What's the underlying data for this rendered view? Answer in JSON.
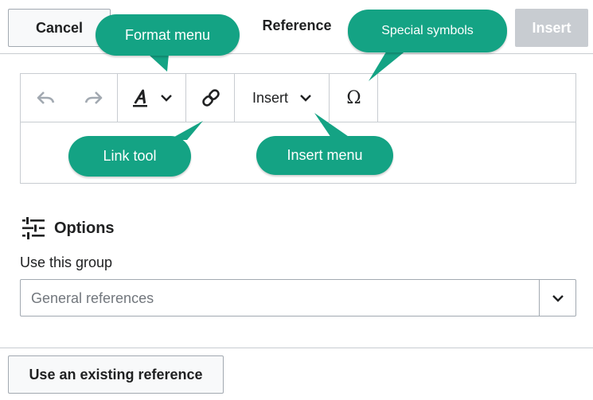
{
  "header": {
    "cancel_label": "Cancel",
    "title": "Reference",
    "insert_label": "Insert"
  },
  "toolbar": {
    "undo_icon": "undo-icon",
    "redo_icon": "redo-icon",
    "format_icon": "text-style-icon",
    "link_icon": "link-icon",
    "insert_label": "Insert",
    "special_symbol": "Ω"
  },
  "options": {
    "title": "Options",
    "icon": "settings-sliders-icon",
    "group_label": "Use this group",
    "group_value": "General references"
  },
  "footer": {
    "use_existing_label": "Use an existing reference"
  },
  "callouts": {
    "format_menu": "Format menu",
    "special_symbols": "Special symbols",
    "link_tool": "Link tool",
    "insert_menu": "Insert menu"
  },
  "colors": {
    "callout": "#14a384",
    "border": "#c8ccd1",
    "disabled_button": "#c8ccd1"
  }
}
